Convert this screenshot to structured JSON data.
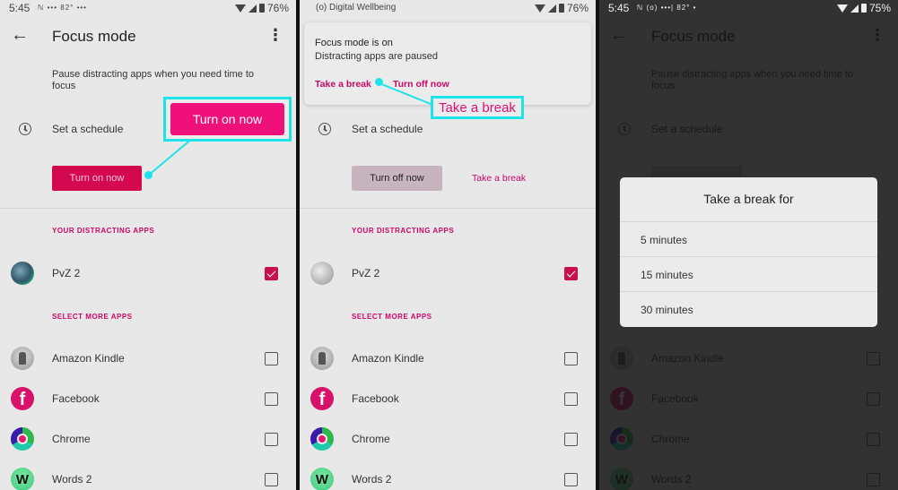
{
  "panels": [
    {
      "status": {
        "time": "5:45",
        "extras": "ℕ ••• 82° •••",
        "battery": "76%"
      },
      "appbar": {
        "title": "Focus mode"
      },
      "description": "Pause distracting apps when you need time to focus",
      "schedule_label": "Set a schedule",
      "primary_button": "Turn on now",
      "callout_button": "Turn on now",
      "section_distracting": "YOUR DISTRACTING APPS",
      "section_more": "SELECT MORE APPS",
      "apps": [
        {
          "name": "PvZ 2",
          "checked": true
        },
        {
          "name": "Amazon Kindle",
          "checked": false
        },
        {
          "name": "Facebook",
          "checked": false
        },
        {
          "name": "Chrome",
          "checked": false
        },
        {
          "name": "Words 2",
          "checked": false
        }
      ]
    },
    {
      "status": {
        "app": "(o) Digital Wellbeing",
        "battery": "76%"
      },
      "notification": {
        "title": "Focus mode is on",
        "subtitle": "Distracting apps are paused",
        "action_break": "Take a break",
        "action_off": "Turn off now"
      },
      "callout_text": "Take a break",
      "schedule_label": "Set a schedule",
      "secondary_button": "Turn off now",
      "text_link": "Take a break",
      "section_distracting": "YOUR DISTRACTING APPS",
      "section_more": "SELECT MORE APPS",
      "apps": [
        {
          "name": "PvZ 2",
          "checked": true
        },
        {
          "name": "Amazon Kindle",
          "checked": false
        },
        {
          "name": "Facebook",
          "checked": false
        },
        {
          "name": "Chrome",
          "checked": false
        },
        {
          "name": "Words 2",
          "checked": false
        }
      ]
    },
    {
      "status": {
        "time": "5:45",
        "extras": "ℕ (o) •••| 82° •",
        "battery": "75%"
      },
      "appbar": {
        "title": "Focus mode"
      },
      "description": "Pause distracting apps when you need time to focus",
      "schedule_label": "Set a schedule",
      "dialog": {
        "title": "Take a break for",
        "options": [
          "5 minutes",
          "15 minutes",
          "30 minutes"
        ]
      },
      "apps": [
        {
          "name": "Amazon Kindle",
          "checked": false
        },
        {
          "name": "Facebook",
          "checked": false
        },
        {
          "name": "Chrome",
          "checked": false
        },
        {
          "name": "Words 2",
          "checked": false
        }
      ]
    }
  ],
  "colors": {
    "accent": "#d0056a",
    "callout": "#1ee4ea",
    "button_primary": "#d4084f",
    "button_secondary": "#c8b4be"
  },
  "icons": {
    "back": "arrow-left",
    "more": "more-vert",
    "schedule": "clock",
    "facebook_glyph": "f",
    "words_glyph": "W"
  }
}
